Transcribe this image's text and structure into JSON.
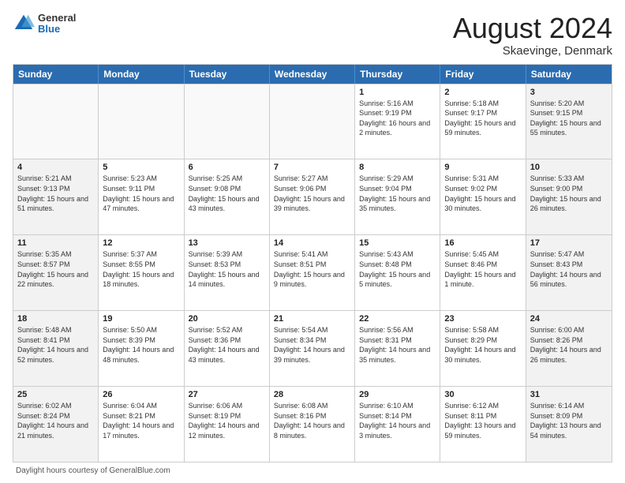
{
  "logo": {
    "general": "General",
    "blue": "Blue"
  },
  "title": {
    "month": "August 2024",
    "location": "Skaevinge, Denmark"
  },
  "header_days": [
    "Sunday",
    "Monday",
    "Tuesday",
    "Wednesday",
    "Thursday",
    "Friday",
    "Saturday"
  ],
  "footer": {
    "label": "Daylight hours"
  },
  "weeks": [
    [
      {
        "day": "",
        "info": "",
        "empty": true
      },
      {
        "day": "",
        "info": "",
        "empty": true
      },
      {
        "day": "",
        "info": "",
        "empty": true
      },
      {
        "day": "",
        "info": "",
        "empty": true
      },
      {
        "day": "1",
        "info": "Sunrise: 5:16 AM\nSunset: 9:19 PM\nDaylight: 16 hours\nand 2 minutes."
      },
      {
        "day": "2",
        "info": "Sunrise: 5:18 AM\nSunset: 9:17 PM\nDaylight: 15 hours\nand 59 minutes."
      },
      {
        "day": "3",
        "info": "Sunrise: 5:20 AM\nSunset: 9:15 PM\nDaylight: 15 hours\nand 55 minutes."
      }
    ],
    [
      {
        "day": "4",
        "info": "Sunrise: 5:21 AM\nSunset: 9:13 PM\nDaylight: 15 hours\nand 51 minutes."
      },
      {
        "day": "5",
        "info": "Sunrise: 5:23 AM\nSunset: 9:11 PM\nDaylight: 15 hours\nand 47 minutes."
      },
      {
        "day": "6",
        "info": "Sunrise: 5:25 AM\nSunset: 9:08 PM\nDaylight: 15 hours\nand 43 minutes."
      },
      {
        "day": "7",
        "info": "Sunrise: 5:27 AM\nSunset: 9:06 PM\nDaylight: 15 hours\nand 39 minutes."
      },
      {
        "day": "8",
        "info": "Sunrise: 5:29 AM\nSunset: 9:04 PM\nDaylight: 15 hours\nand 35 minutes."
      },
      {
        "day": "9",
        "info": "Sunrise: 5:31 AM\nSunset: 9:02 PM\nDaylight: 15 hours\nand 30 minutes."
      },
      {
        "day": "10",
        "info": "Sunrise: 5:33 AM\nSunset: 9:00 PM\nDaylight: 15 hours\nand 26 minutes."
      }
    ],
    [
      {
        "day": "11",
        "info": "Sunrise: 5:35 AM\nSunset: 8:57 PM\nDaylight: 15 hours\nand 22 minutes."
      },
      {
        "day": "12",
        "info": "Sunrise: 5:37 AM\nSunset: 8:55 PM\nDaylight: 15 hours\nand 18 minutes."
      },
      {
        "day": "13",
        "info": "Sunrise: 5:39 AM\nSunset: 8:53 PM\nDaylight: 15 hours\nand 14 minutes."
      },
      {
        "day": "14",
        "info": "Sunrise: 5:41 AM\nSunset: 8:51 PM\nDaylight: 15 hours\nand 9 minutes."
      },
      {
        "day": "15",
        "info": "Sunrise: 5:43 AM\nSunset: 8:48 PM\nDaylight: 15 hours\nand 5 minutes."
      },
      {
        "day": "16",
        "info": "Sunrise: 5:45 AM\nSunset: 8:46 PM\nDaylight: 15 hours\nand 1 minute."
      },
      {
        "day": "17",
        "info": "Sunrise: 5:47 AM\nSunset: 8:43 PM\nDaylight: 14 hours\nand 56 minutes."
      }
    ],
    [
      {
        "day": "18",
        "info": "Sunrise: 5:48 AM\nSunset: 8:41 PM\nDaylight: 14 hours\nand 52 minutes."
      },
      {
        "day": "19",
        "info": "Sunrise: 5:50 AM\nSunset: 8:39 PM\nDaylight: 14 hours\nand 48 minutes."
      },
      {
        "day": "20",
        "info": "Sunrise: 5:52 AM\nSunset: 8:36 PM\nDaylight: 14 hours\nand 43 minutes."
      },
      {
        "day": "21",
        "info": "Sunrise: 5:54 AM\nSunset: 8:34 PM\nDaylight: 14 hours\nand 39 minutes."
      },
      {
        "day": "22",
        "info": "Sunrise: 5:56 AM\nSunset: 8:31 PM\nDaylight: 14 hours\nand 35 minutes."
      },
      {
        "day": "23",
        "info": "Sunrise: 5:58 AM\nSunset: 8:29 PM\nDaylight: 14 hours\nand 30 minutes."
      },
      {
        "day": "24",
        "info": "Sunrise: 6:00 AM\nSunset: 8:26 PM\nDaylight: 14 hours\nand 26 minutes."
      }
    ],
    [
      {
        "day": "25",
        "info": "Sunrise: 6:02 AM\nSunset: 8:24 PM\nDaylight: 14 hours\nand 21 minutes."
      },
      {
        "day": "26",
        "info": "Sunrise: 6:04 AM\nSunset: 8:21 PM\nDaylight: 14 hours\nand 17 minutes."
      },
      {
        "day": "27",
        "info": "Sunrise: 6:06 AM\nSunset: 8:19 PM\nDaylight: 14 hours\nand 12 minutes."
      },
      {
        "day": "28",
        "info": "Sunrise: 6:08 AM\nSunset: 8:16 PM\nDaylight: 14 hours\nand 8 minutes."
      },
      {
        "day": "29",
        "info": "Sunrise: 6:10 AM\nSunset: 8:14 PM\nDaylight: 14 hours\nand 3 minutes."
      },
      {
        "day": "30",
        "info": "Sunrise: 6:12 AM\nSunset: 8:11 PM\nDaylight: 13 hours\nand 59 minutes."
      },
      {
        "day": "31",
        "info": "Sunrise: 6:14 AM\nSunset: 8:09 PM\nDaylight: 13 hours\nand 54 minutes."
      }
    ]
  ]
}
